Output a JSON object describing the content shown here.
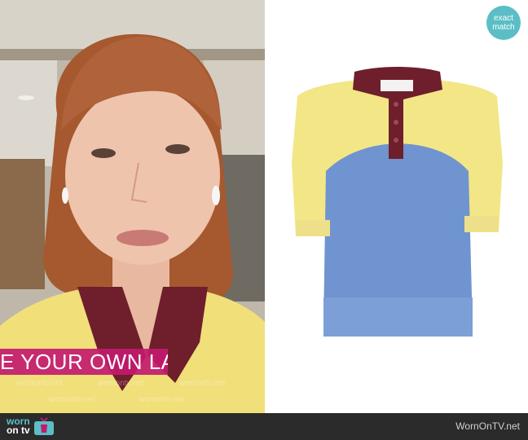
{
  "banner": {
    "text": "E YOUR OWN LA"
  },
  "badge": {
    "line1": "exact",
    "line2": "match"
  },
  "footer": {
    "logo_worn": "worn",
    "logo_on": "on",
    "logo_tv": "tv",
    "site_name": "WornOnTV.net"
  },
  "watermarks": [
    "wornontv.net",
    "wornontv.net",
    "wornontv.net",
    "wornontv.net",
    "wornontv.net"
  ],
  "colors": {
    "accent": "#5bbec6",
    "banner": "#c21a6e",
    "shirt_yellow": "#f3e687",
    "shirt_blue": "#6f94cf",
    "collar": "#6e1f2b",
    "footer": "#2b2b2b"
  }
}
